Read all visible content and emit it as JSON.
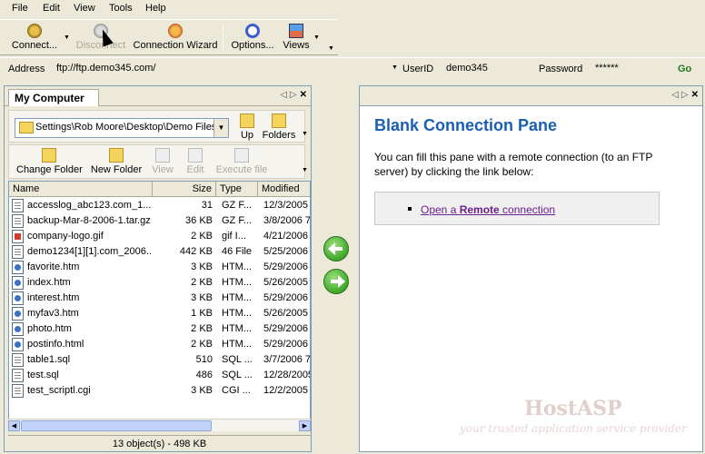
{
  "menu": [
    "File",
    "Edit",
    "View",
    "Tools",
    "Help"
  ],
  "toolbar": {
    "connect": "Connect...",
    "disconnect": "Disconnect",
    "wizard": "Connection Wizard",
    "options": "Options...",
    "views": "Views"
  },
  "address": {
    "label": "Address",
    "value": "ftp://ftp.demo345.com/",
    "userid_label": "UserID",
    "userid_value": "demo345",
    "password_label": "Password",
    "password_value": "******",
    "go": "Go"
  },
  "left_pane": {
    "tab": "My Computer",
    "path": "Settings\\Rob Moore\\Desktop\\Demo Files",
    "up": "Up",
    "folders": "Folders",
    "change_folder": "Change Folder",
    "new_folder": "New Folder",
    "view": "View",
    "edit": "Edit",
    "execute": "Execute file",
    "columns": [
      "Name",
      "Size",
      "Type",
      "Modified"
    ],
    "files": [
      {
        "name": "accesslog_abc123.com_1...",
        "size": "31",
        "type": "GZ F...",
        "modified": "12/3/2005",
        "icon": "doc"
      },
      {
        "name": "backup-Mar-8-2006-1.tar.gz",
        "size": "36 KB",
        "type": "GZ F...",
        "modified": "3/8/2006 7",
        "icon": "doc"
      },
      {
        "name": "company-logo.gif",
        "size": "2 KB",
        "type": "gif I...",
        "modified": "4/21/2006",
        "icon": "gif"
      },
      {
        "name": "demo1234[1][1].com_2006...",
        "size": "442 KB",
        "type": "46 File",
        "modified": "5/25/2006",
        "icon": "doc"
      },
      {
        "name": "favorite.htm",
        "size": "3 KB",
        "type": "HTM...",
        "modified": "5/29/2006",
        "icon": "web"
      },
      {
        "name": "index.htm",
        "size": "2 KB",
        "type": "HTM...",
        "modified": "5/26/2005",
        "icon": "web"
      },
      {
        "name": "interest.htm",
        "size": "3 KB",
        "type": "HTM...",
        "modified": "5/29/2006",
        "icon": "web"
      },
      {
        "name": "myfav3.htm",
        "size": "1 KB",
        "type": "HTM...",
        "modified": "5/26/2005",
        "icon": "web"
      },
      {
        "name": "photo.htm",
        "size": "2 KB",
        "type": "HTM...",
        "modified": "5/29/2006",
        "icon": "web"
      },
      {
        "name": "postinfo.html",
        "size": "2 KB",
        "type": "HTM...",
        "modified": "5/29/2006",
        "icon": "web"
      },
      {
        "name": "table1.sql",
        "size": "510",
        "type": "SQL ...",
        "modified": "3/7/2006 7",
        "icon": "doc"
      },
      {
        "name": "test.sql",
        "size": "486",
        "type": "SQL ...",
        "modified": "12/28/2005",
        "icon": "doc"
      },
      {
        "name": "test_scriptl.cgi",
        "size": "3 KB",
        "type": "CGI ...",
        "modified": "12/2/2005",
        "icon": "doc"
      }
    ],
    "status": "13 object(s) - 498 KB"
  },
  "right_pane": {
    "title": "Blank Connection Pane",
    "description": "You can fill this pane with a remote connection (to an FTP server) by clicking the link below:",
    "link_prefix": "Open a ",
    "link_bold": "Remote",
    "link_suffix": " connection"
  },
  "watermark": {
    "brand": "HostASP",
    "tagline": "your trusted application service provider"
  }
}
